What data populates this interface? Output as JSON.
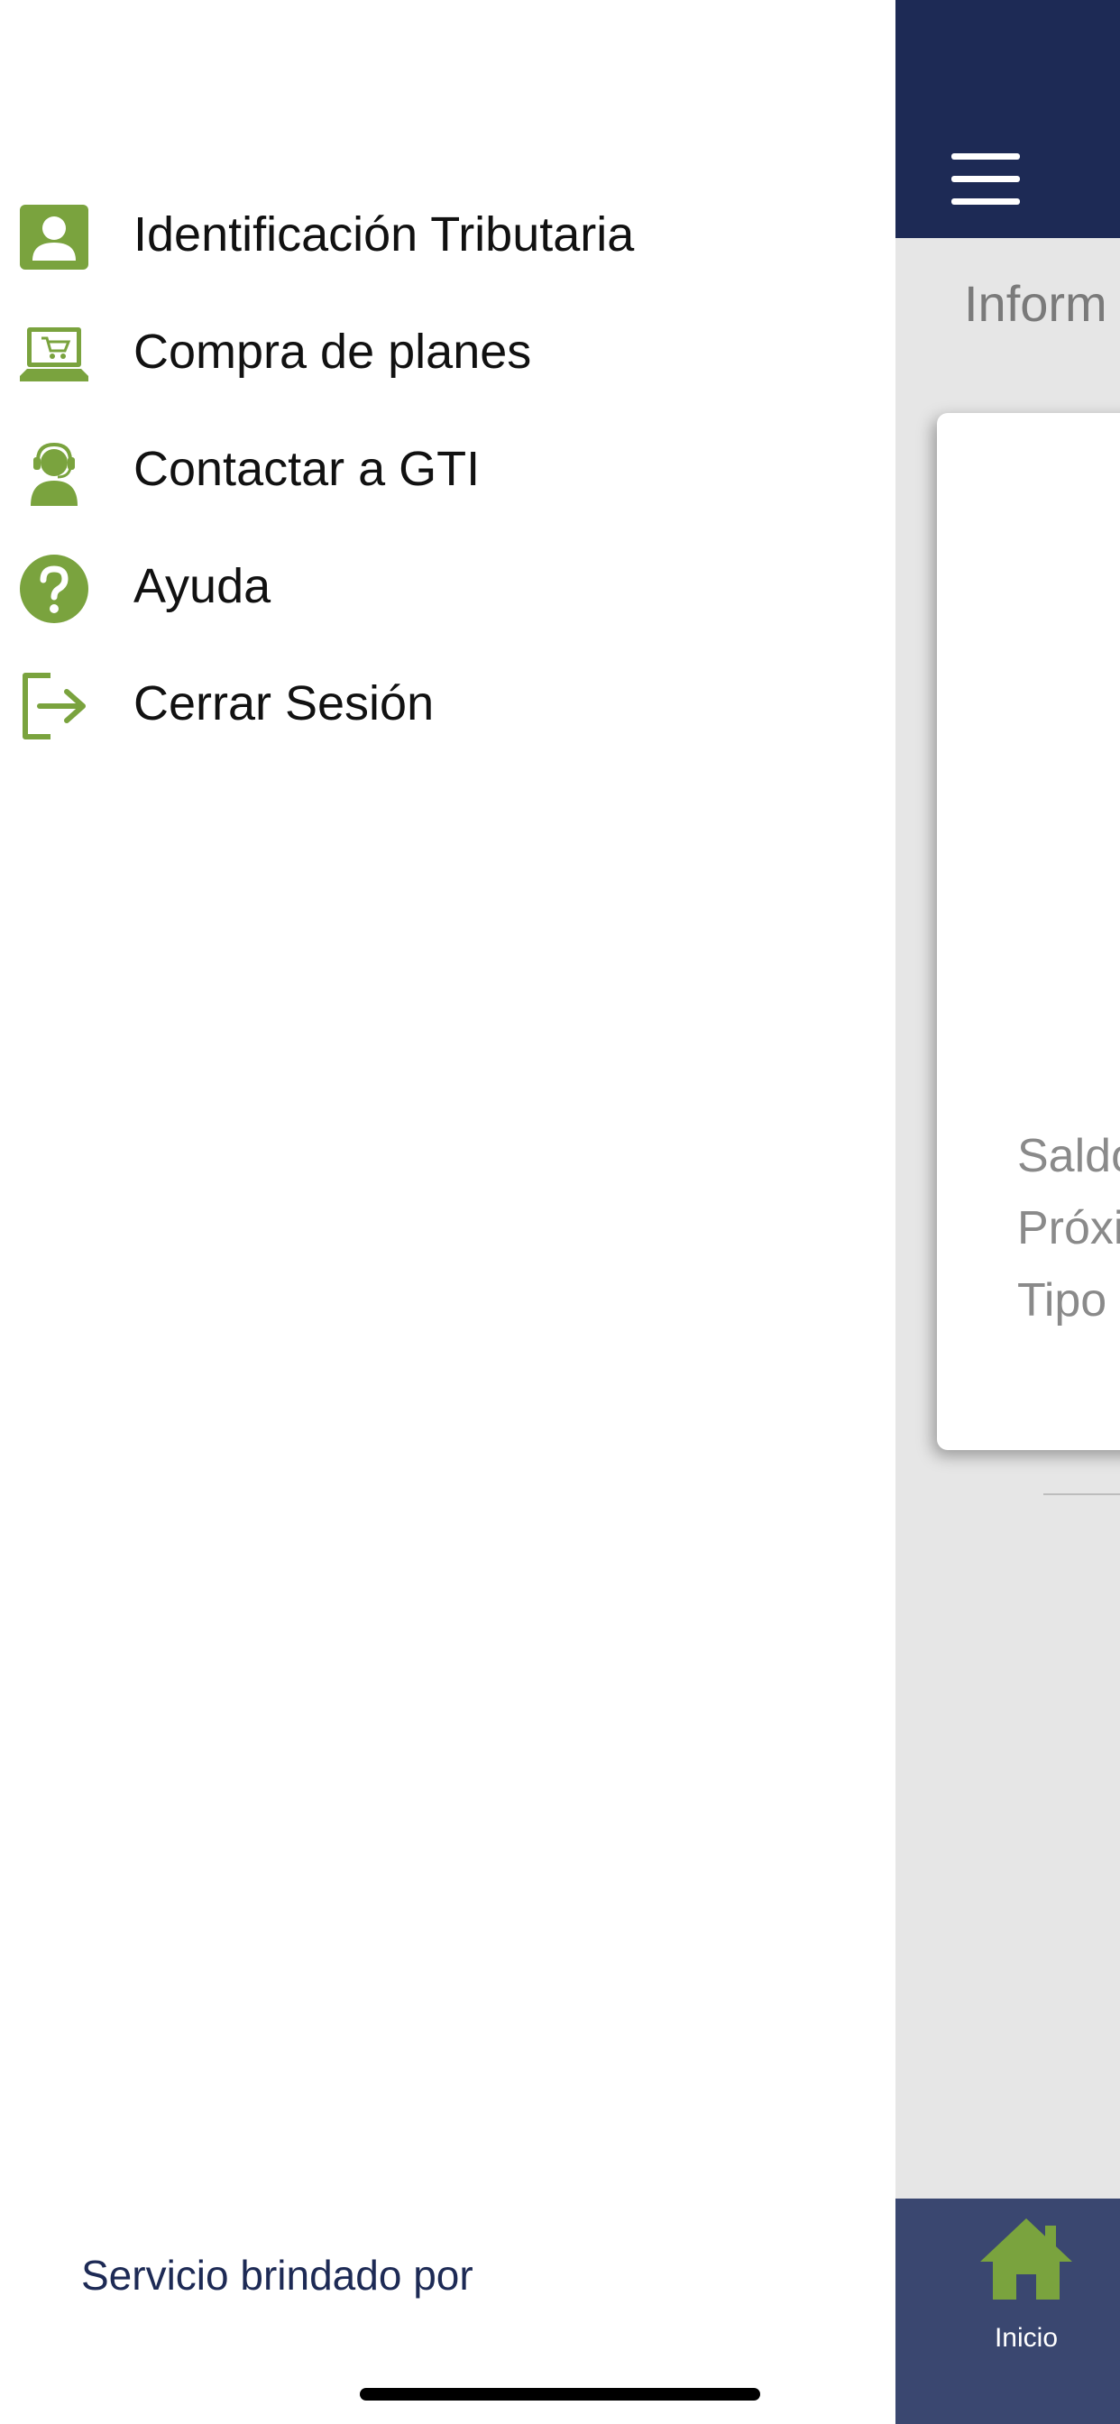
{
  "colors": {
    "header_navy": "#1d2a55",
    "bottom_nav": "#3a4770",
    "accent_green": "#7aa33e",
    "content_gray": "#e6e6e6"
  },
  "drawer": {
    "items": [
      {
        "label": "Identificación Tributaria",
        "icon": "user-id-icon"
      },
      {
        "label": "Compra de planes",
        "icon": "laptop-cart-icon"
      },
      {
        "label": "Contactar a GTI",
        "icon": "support-agent-icon"
      },
      {
        "label": "Ayuda",
        "icon": "help-icon"
      },
      {
        "label": "Cerrar Sesión",
        "icon": "logout-icon"
      }
    ],
    "footer_text": "Servicio brindado por"
  },
  "app": {
    "header_menu_icon": "hamburger-menu-icon",
    "section_title": "Inform",
    "card_lines": [
      "Saldo",
      "Próxi",
      "Tipo"
    ],
    "bottom_nav": {
      "home_label": "Inicio",
      "home_icon": "home-icon"
    }
  }
}
